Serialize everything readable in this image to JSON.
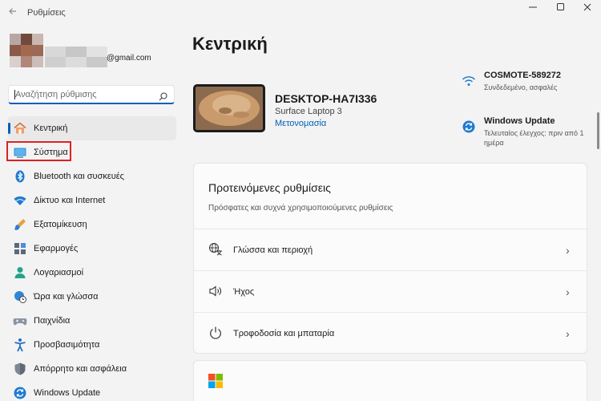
{
  "window": {
    "title": "Ρυθμίσεις",
    "back_icon": "back-arrow-icon",
    "minimize_glyph": "—",
    "maximize_glyph": "☐",
    "close_glyph": "✕"
  },
  "profile": {
    "email_suffix": "@gmail.com"
  },
  "search": {
    "placeholder": "Αναζήτηση ρύθμισης"
  },
  "sidebar": {
    "items": [
      {
        "label": "Κεντρική",
        "icon": "home-icon"
      },
      {
        "label": "Σύστημα",
        "icon": "system-icon"
      },
      {
        "label": "Bluetooth και συσκευές",
        "icon": "bluetooth-icon"
      },
      {
        "label": "Δίκτυο και Internet",
        "icon": "wifi-icon"
      },
      {
        "label": "Εξατομίκευση",
        "icon": "brush-icon"
      },
      {
        "label": "Εφαρμογές",
        "icon": "apps-icon"
      },
      {
        "label": "Λογαριασμοί",
        "icon": "person-icon"
      },
      {
        "label": "Ώρα και γλώσσα",
        "icon": "globe-clock-icon"
      },
      {
        "label": "Παιχνίδια",
        "icon": "gamepad-icon"
      },
      {
        "label": "Προσβασιμότητα",
        "icon": "accessibility-icon"
      },
      {
        "label": "Απόρρητο και ασφάλεια",
        "icon": "shield-icon"
      },
      {
        "label": "Windows Update",
        "icon": "update-icon"
      }
    ]
  },
  "main": {
    "title": "Κεντρική",
    "device": {
      "name": "DESKTOP-HA7I336",
      "model": "Surface Laptop 3",
      "rename_link": "Μετονομασία"
    },
    "network": {
      "title": "COSMOTE-589272",
      "subtitle": "Συνδεδεμένο, ασφαλές"
    },
    "update": {
      "title": "Windows Update",
      "subtitle_line1": "Τελευταίος έλεγχος: πριν από 1",
      "subtitle_line2": "ημέρα"
    },
    "recommended": {
      "title": "Προτεινόμενες ρυθμίσεις",
      "subtitle": "Πρόσφατες και συχνά χρησιμοποιούμενες ρυθμίσεις",
      "rows": [
        {
          "label": "Γλώσσα και περιοχή",
          "icon": "language-icon"
        },
        {
          "label": "Ήχος",
          "icon": "speaker-icon"
        },
        {
          "label": "Τροφοδοσία και μπαταρία",
          "icon": "power-icon"
        }
      ],
      "chevron": "›"
    }
  },
  "colors": {
    "accent": "#005fb8",
    "highlight": "#e02020",
    "background": "#f3f3f3"
  }
}
